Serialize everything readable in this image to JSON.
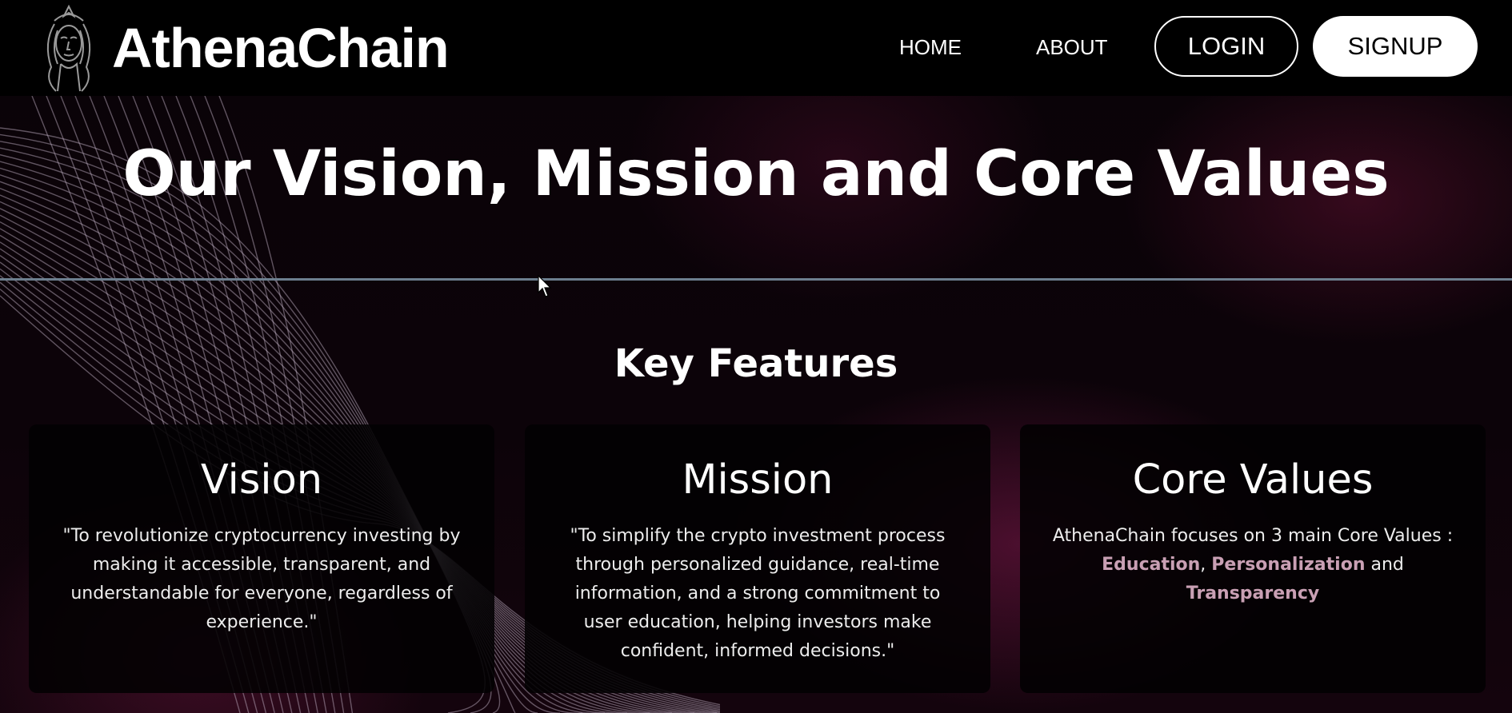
{
  "header": {
    "brand": "AthenaChain",
    "nav": {
      "home": "HOME",
      "about": "ABOUT"
    },
    "login_label": "LOGIN",
    "signup_label": "SIGNUP"
  },
  "main": {
    "title": "Our Vision, Mission and Core Values",
    "subtitle": "Key Features",
    "cards": {
      "vision": {
        "heading": "Vision",
        "text": "\"To revolutionize cryptocurrency investing by making it accessible, transparent, and understandable for everyone, regardless of experience.\""
      },
      "mission": {
        "heading": "Mission",
        "text": "\"To simplify the crypto investment process through personalized guidance, real-time information, and a strong commitment to user education, helping investors make confident, informed decisions.\""
      },
      "core_values": {
        "heading": "Core Values",
        "intro": "AthenaChain focuses on 3 main Core Values :",
        "values": [
          "Education",
          "Personalization",
          "Transparency"
        ],
        "sep1": ",",
        "sep2": "and"
      }
    }
  },
  "colors": {
    "background": "#000000",
    "highlight": "#c9a0b4",
    "divider": "#6d7f8f",
    "signup_bg": "#ffffff"
  },
  "icons": {
    "logo": "athena-goddess-logo",
    "cursor": "mouse-pointer"
  }
}
